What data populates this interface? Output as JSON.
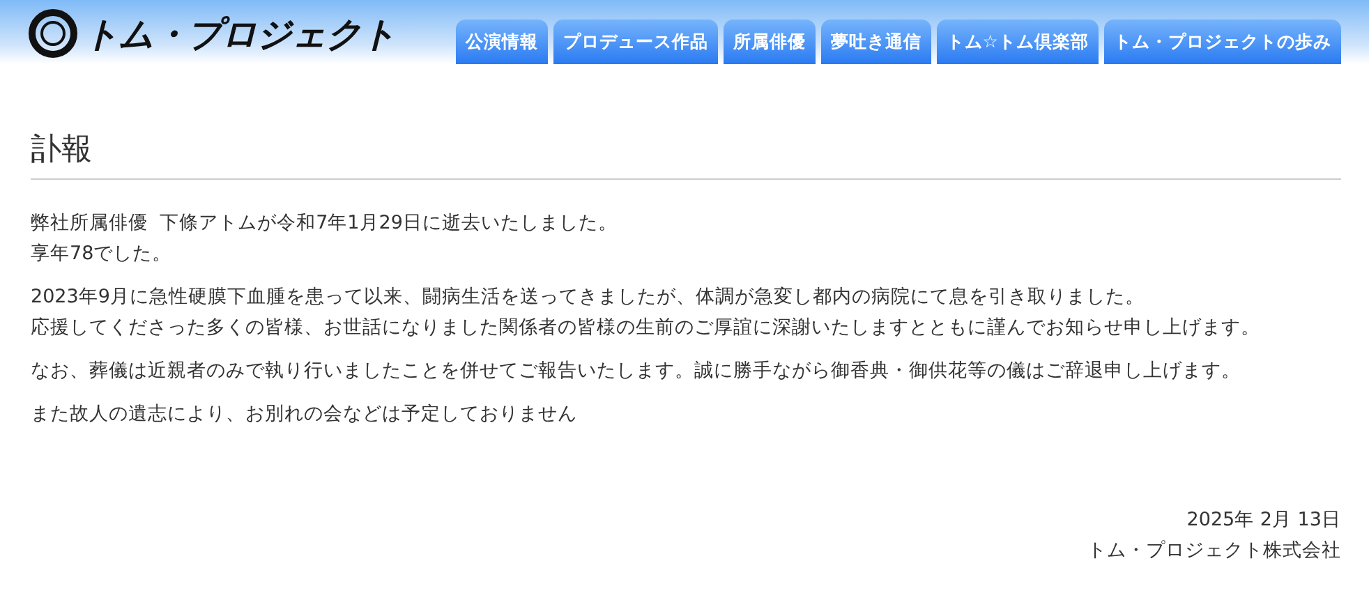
{
  "header": {
    "logo_text": "トム・プロジェクト"
  },
  "nav": [
    {
      "label": "公演情報"
    },
    {
      "label": "プロデュース作品"
    },
    {
      "label": "所属俳優"
    },
    {
      "label": "夢吐き通信"
    },
    {
      "label": "トム☆トム倶楽部"
    },
    {
      "label": "トム・プロジェクトの歩み"
    }
  ],
  "page_title": "訃報",
  "paragraphs": [
    [
      "弊社所属俳優  下條アトムが令和7年1月29日に逝去いたしました。",
      "享年78でした。"
    ],
    [
      "2023年9月に急性硬膜下血腫を患って以来、闘病生活を送ってきましたが、体調が急変し都内の病院にて息を引き取りました。",
      "応援してくださった多くの皆様、お世話になりました関係者の皆様の生前のご厚誼に深謝いたしますとともに謹んでお知らせ申し上げます。"
    ],
    [
      "なお、葬儀は近親者のみで執り行いましたことを併せてご報告いたします。誠に勝手ながら御香典・御供花等の儀はご辞退申し上げます。"
    ],
    [
      "また故人の遺志により、お別れの会などは予定しておりません"
    ]
  ],
  "signature": {
    "date": "2025年 2月 13日",
    "company": "トム・プロジェクト株式会社"
  }
}
